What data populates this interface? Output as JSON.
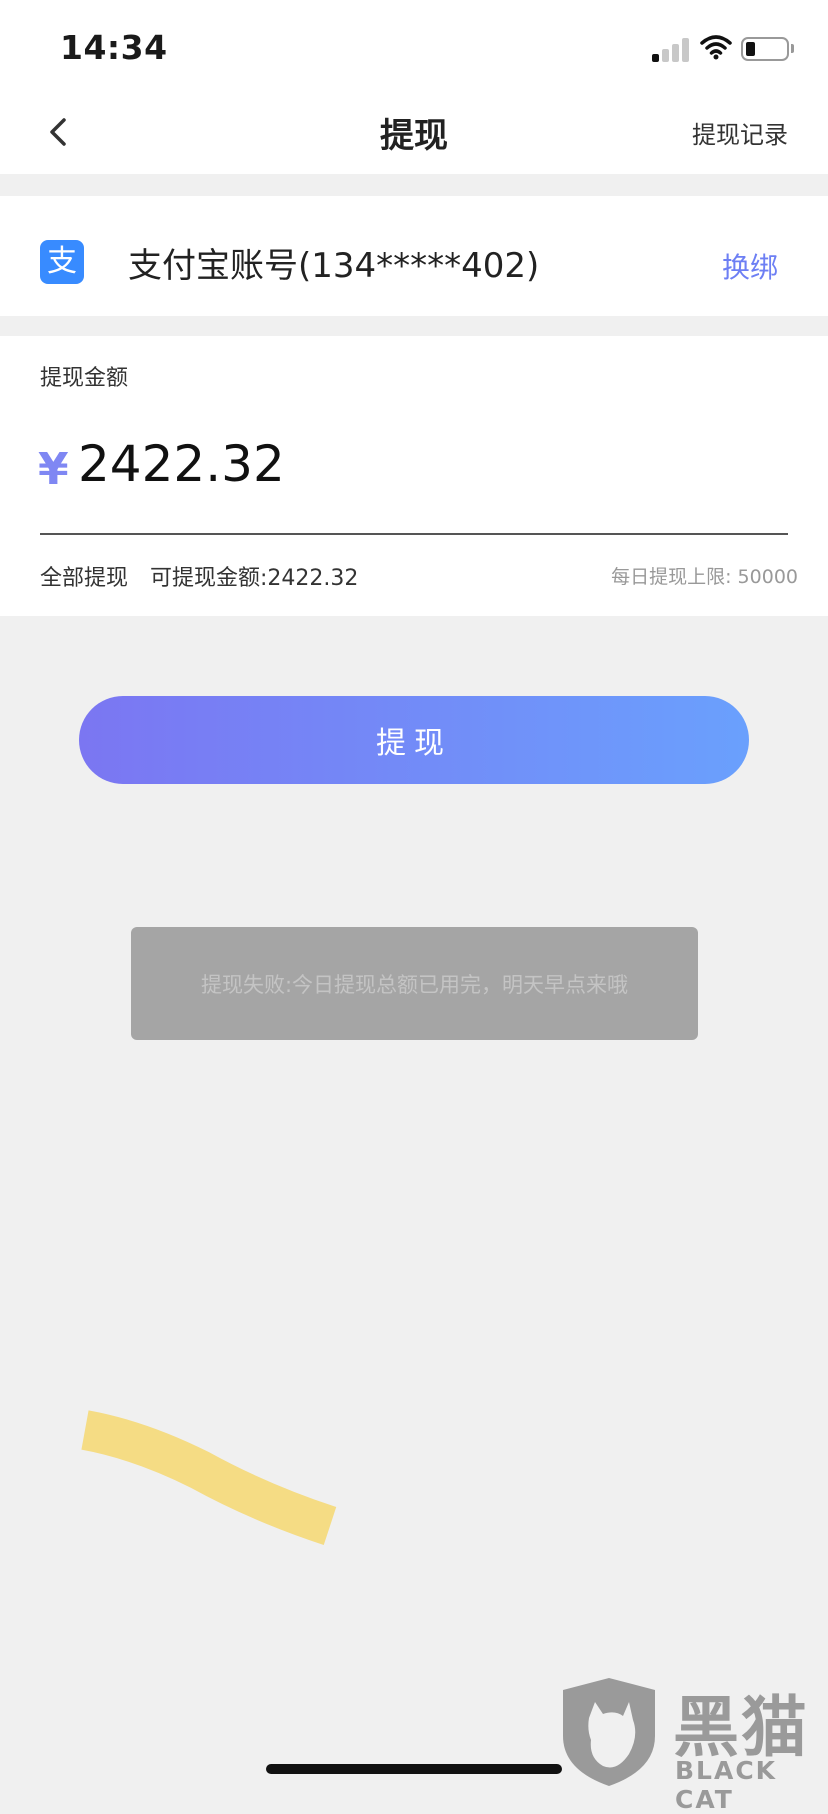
{
  "status_bar": {
    "time": "14:34",
    "signal_bars_active": 1,
    "signal_bars_total": 4,
    "battery_level_percent": 20
  },
  "nav": {
    "back_icon": "chevron-left-icon",
    "title": "提现",
    "right_link": "提现记录"
  },
  "account": {
    "icon": "alipay-icon",
    "icon_glyph": "支",
    "label": "支付宝账号(134*****402)",
    "change_label": "换绑"
  },
  "amount": {
    "label": "提现金额",
    "currency": "¥",
    "value": "2422.32",
    "withdraw_all_label": "全部提现",
    "available_text": "可提现金额:2422.32",
    "daily_limit_text": "每日提现上限: 50000"
  },
  "submit": {
    "label": "提现"
  },
  "toast": {
    "message": "提现失败:今日提现总额已用完，明天早点来哦"
  },
  "watermark": {
    "cn_text": "黑猫",
    "en_text": "BLACK CAT"
  },
  "colors": {
    "accent": "#6d7ff4",
    "button_gradient_start": "#7b76f2",
    "button_gradient_end": "#6aa0fd",
    "toast_bg": "#a5a5a5",
    "highlight": "#f5d978"
  }
}
